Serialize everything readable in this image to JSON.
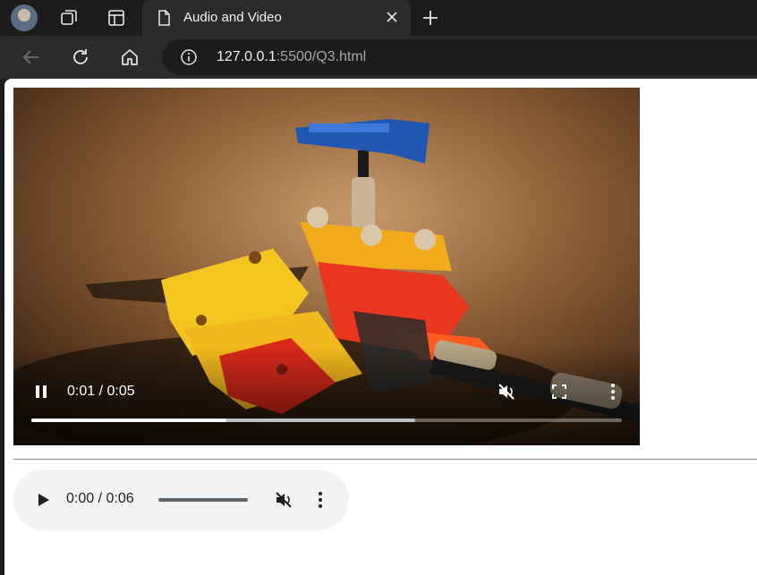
{
  "browser": {
    "tab": {
      "title": "Audio and Video"
    },
    "address": {
      "host": "127.0.0.1",
      "rest": ":5500/Q3.html"
    },
    "icons": [
      "avatar",
      "workspaces-icon",
      "tab-actions-icon",
      "page-icon",
      "close-icon",
      "new-tab-icon",
      "back-icon",
      "reload-icon",
      "home-icon",
      "site-info-icon"
    ]
  },
  "video": {
    "time": "0:01 / 0:05",
    "played_fraction": 0.33,
    "buffered_fraction": 0.65,
    "state": "playing",
    "muted": true
  },
  "audio": {
    "time": "0:00 / 0:06",
    "state": "paused",
    "muted": true
  }
}
